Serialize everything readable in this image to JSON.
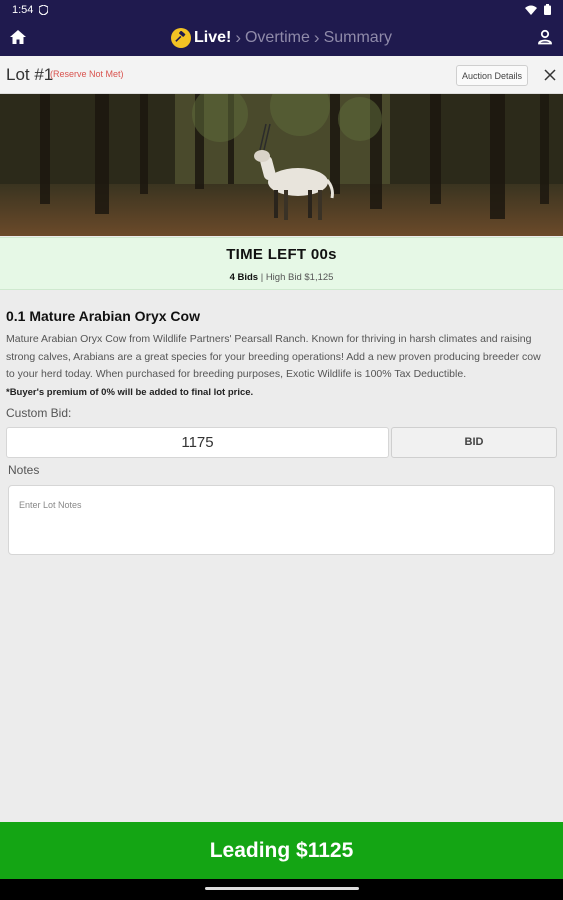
{
  "status": {
    "time": "1:54"
  },
  "nav": {
    "live": "Live!",
    "overtime": "Overtime",
    "summary": "Summary"
  },
  "lot": {
    "title": "Lot #1",
    "reserve": "(Reserve Not Met)",
    "details_label": "Auction Details"
  },
  "timer": {
    "time_left": "TIME LEFT 00s",
    "bids_count": "4 Bids",
    "high_bid": " | High Bid $1,125"
  },
  "item": {
    "title": "0.1 Mature Arabian Oryx Cow",
    "description": "Mature Arabian Oryx Cow from Wildlife Partners' Pearsall Ranch. Known for thriving in harsh climates and raising strong calves, Arabians are a great species for your breeding operations! Add a new proven producing breeder cow to your herd today. When purchased for breeding purposes, Exotic Wildlife is 100% Tax Deductible.",
    "premium_note": "*Buyer's premium of 0% will be added to final lot price."
  },
  "bid": {
    "label": "Custom Bid:",
    "value": "1175",
    "button_label": "BID"
  },
  "notes": {
    "label": "Notes",
    "placeholder": "Enter Lot Notes"
  },
  "footer": {
    "leading": "Leading $1125"
  },
  "colors": {
    "header": "#1f1a4e",
    "leading": "#14a514",
    "timer_bg": "#e6f8e6",
    "reserve": "#d9534f"
  },
  "icons": [
    "home-icon",
    "gavel-icon",
    "profile-icon",
    "close-icon",
    "wifi-icon",
    "battery-icon"
  ]
}
